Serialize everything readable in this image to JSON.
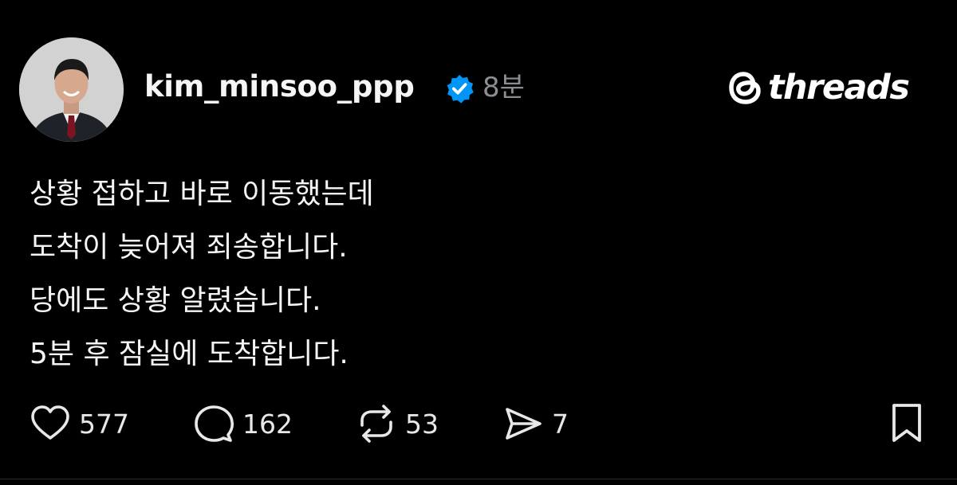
{
  "post": {
    "username": "kim_minsoo_ppp",
    "verified": true,
    "timestamp": "8분",
    "avatar_icon": "profile-photo",
    "text_lines": [
      "상황 접하고 바로 이동했는데",
      "도착이 늦어져 죄송합니다.",
      "당에도 상황 알렸습니다.",
      "5분 후 잠실에 도착합니다."
    ]
  },
  "brand": {
    "name": "threads",
    "icon": "threads-logo-icon"
  },
  "actions": {
    "like": {
      "icon": "heart-icon",
      "count": "577"
    },
    "reply": {
      "icon": "comment-icon",
      "count": "162"
    },
    "repost": {
      "icon": "repost-icon",
      "count": "53"
    },
    "share": {
      "icon": "send-icon",
      "count": "7"
    },
    "bookmark": {
      "icon": "bookmark-icon"
    }
  },
  "colors": {
    "background": "#000000",
    "text": "#f3f5f7",
    "muted": "#8a8d91",
    "verified_badge": "#0095f6"
  }
}
